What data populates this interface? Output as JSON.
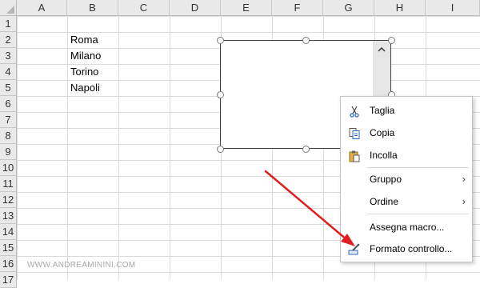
{
  "columns": [
    "A",
    "B",
    "C",
    "D",
    "E",
    "F",
    "G",
    "H",
    "I"
  ],
  "rows": [
    "1",
    "2",
    "3",
    "4",
    "5",
    "6",
    "7",
    "8",
    "9",
    "10",
    "11",
    "12",
    "13",
    "14",
    "15",
    "16",
    "17"
  ],
  "cells": {
    "b2": "Roma",
    "b3": "Milano",
    "b4": "Torino",
    "b5": "Napoli"
  },
  "context_menu": {
    "taglia": "Taglia",
    "copia": "Copia",
    "incolla": "Incolla",
    "gruppo": "Gruppo",
    "ordine": "Ordine",
    "assegna_macro": "Assegna macro...",
    "formato_controllo": "Formato controllo..."
  },
  "watermark": "WWW.ANDREAMININI.COM",
  "colors": {
    "arrow": "#e02020",
    "header_bg": "#e9e9e9",
    "gridline": "#dadada"
  },
  "icons": {
    "cut": "scissors-icon",
    "copy": "copy-icon",
    "paste": "clipboard-icon",
    "format": "format-control-icon",
    "submenu": "chevron-right-icon",
    "scroll_up": "chevron-up-icon"
  }
}
